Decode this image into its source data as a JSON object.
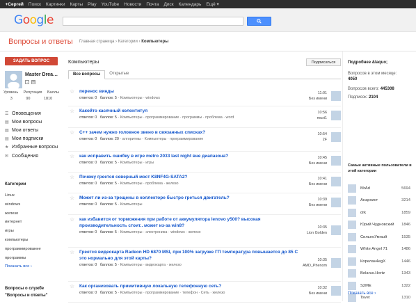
{
  "topbar": [
    "+Сергей",
    "Поиск",
    "Картинки",
    "Карты",
    "Play",
    "YouTube",
    "Новости",
    "Почта",
    "Диск",
    "Календарь",
    "Ещё ▾"
  ],
  "logo": "Google",
  "app_title": "Вопросы и ответы",
  "breadcrumb": {
    "home": "Главная страница",
    "cats": "Категории",
    "current": "Компьютеры",
    "sep": "›"
  },
  "left": {
    "ask_button": "ЗАДАТЬ ВОПРОС",
    "user_name": "Master Drea…",
    "stats_labels": [
      "Уровень",
      "Репутация",
      "Баллы"
    ],
    "stats_values": [
      "3",
      "90",
      "1810"
    ],
    "nav": [
      {
        "icon": "☰",
        "label": "Оповещения"
      },
      {
        "icon": "▤",
        "label": "Мои вопросы"
      },
      {
        "icon": "▤",
        "label": "Мои ответы"
      },
      {
        "icon": "▤",
        "label": "Мои подписки"
      },
      {
        "icon": "★",
        "label": "Избранные вопросы"
      },
      {
        "icon": "✉",
        "label": "Сообщения"
      }
    ],
    "categories_title": "Категории",
    "categories": [
      "Linux",
      "windows",
      "железо",
      "интернет",
      "игры",
      "компьютеры",
      "программирование",
      "программы"
    ],
    "show_all": "Показать все ›",
    "service_q": "Вопросы о службе",
    "service_q2": "\"Вопросы и ответы\""
  },
  "main": {
    "title": "Компьютеры",
    "subscribe": "Подписаться",
    "tabs": [
      "Все вопросы",
      "Открытые"
    ],
    "questions": [
      {
        "title": "перенос винды",
        "answers": "ответов: 0",
        "points": "баллов: 5",
        "tags": [
          "Компьютеры",
          "windows"
        ],
        "time": "11:01",
        "who": "Без имени"
      },
      {
        "title": "Какойто касячный колонтитул",
        "answers": "ответов: 0",
        "points": "баллов: 5",
        "tags": [
          "Компьютеры",
          "программирование",
          "программы",
          "проблема",
          "word"
        ],
        "time": "10:56",
        "who": "muxi1"
      },
      {
        "title": "С++ зачем нужно головное звено в связанных списках?",
        "answers": "ответов: 0",
        "points": "баллов: 20",
        "tags": [
          "алгоритмы",
          "Компьютеры",
          "программирование"
        ],
        "time": "10:54",
        "who": "2F"
      },
      {
        "title": "как исправить ошибку в игре metro 2033 last night вне диапазона?",
        "answers": "ответов: 0",
        "points": "баллов: 5",
        "tags": [
          "Компьютеры",
          "игры"
        ],
        "time": "10:45",
        "who": "Без имени"
      },
      {
        "title": "Почему греется северный мост K8NF4G-SATA2?",
        "answers": "ответов: 0",
        "points": "баллов: 5",
        "tags": [
          "Компьютеры",
          "проблема",
          "железо"
        ],
        "time": "10:41",
        "who": "Без имени"
      },
      {
        "title": "Может ли из-за трещены в коллекторе быстро греться двигатель?",
        "answers": "ответов: 0",
        "points": "баллов: 5",
        "tags": [
          "Компьютеры"
        ],
        "time": "10:39",
        "who": "Без имени"
      },
      {
        "title": "как избавится от торможения при работе от аккумулятора lenovo y500? высокая производительность стоит.. может из-за win8?",
        "answers": "ответов: 0",
        "points": "баллов: 5",
        "tags": [
          "Компьютеры",
          "электроника",
          "windows",
          "железо"
        ],
        "time": "10:35",
        "who": "Lion Golden"
      },
      {
        "title": "Греется видеокарта Radeon HD 6870 MSI, при 100% загрузке ГП температура повышается до 85 С это нормально для этой карты?",
        "answers": "ответов: 0",
        "points": "баллов: 5",
        "tags": [
          "Компьютеры",
          "видеокарта",
          "железо"
        ],
        "time": "10:35",
        "who": "AMD_Phenom"
      },
      {
        "title": "Как организовать примитивную локальную телефонную сеть?",
        "answers": "ответов: 0",
        "points": "баллов: 5",
        "tags": [
          "Компьютеры",
          "программирование",
          "телефон",
          "Сеть",
          "железо"
        ],
        "time": "10:32",
        "who": "Без имени"
      }
    ]
  },
  "right": {
    "title": "Подробнее &laquo;",
    "month_label": "Вопросов в этом месяце:",
    "month_value": "4050",
    "total_label": "Вопросов всего:",
    "total_value": "445308",
    "subs_label": "Подписок:",
    "subs_value": "2104",
    "active_title": "Самые активные пользователи в этой категории",
    "users": [
      {
        "name": "MrAd",
        "score": "5694"
      },
      {
        "name": "Анархист",
        "score": "3214"
      },
      {
        "name": "drk",
        "score": "1859"
      },
      {
        "name": "Юрий Чудновский",
        "score": "1846"
      },
      {
        "name": "СильноУмный",
        "score": "1535"
      },
      {
        "name": "White Angel 71",
        "score": "1486"
      },
      {
        "name": "Корелан4egX",
        "score": "1446"
      },
      {
        "name": "Belarus.Hortz",
        "score": "1343"
      },
      {
        "name": "S2ME",
        "score": "1322"
      },
      {
        "name": "Tsvet",
        "score": "1310"
      }
    ],
    "show_all": "Показать все ›"
  }
}
